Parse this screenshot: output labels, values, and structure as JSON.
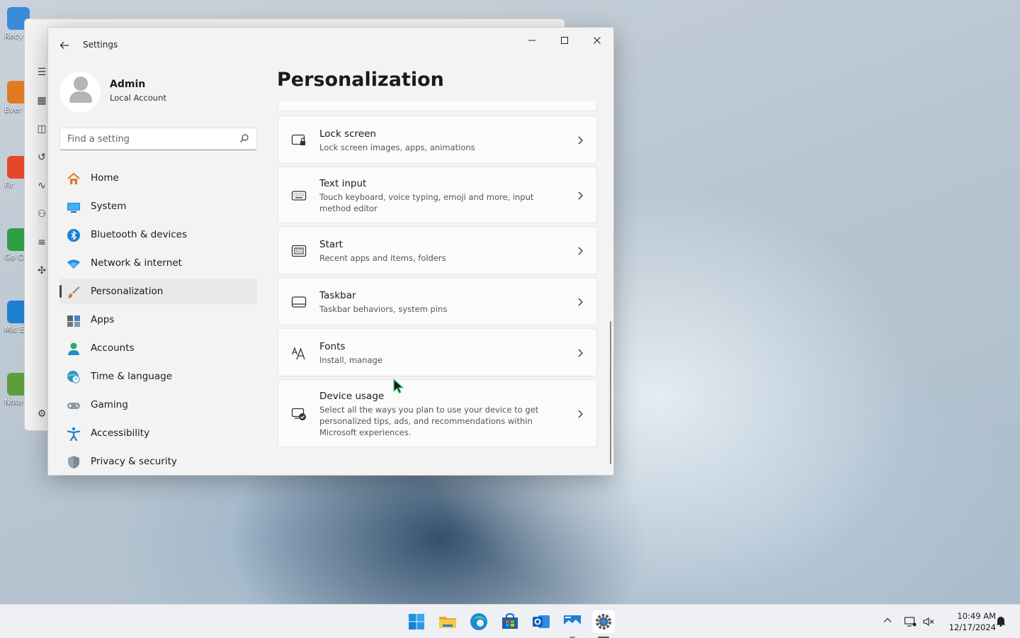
{
  "desktop": {
    "icons": [
      {
        "label": "Recy",
        "color": "#3b8ad9"
      },
      {
        "label": "Ever",
        "color": "#e07b20"
      },
      {
        "label": "Fir",
        "color": "#e5472a"
      },
      {
        "label": "Go Chr",
        "color": "#2f9e44"
      },
      {
        "label": "Mic Ed",
        "color": "#1f7fd1"
      },
      {
        "label": "Note",
        "color": "#5b9e3a"
      }
    ]
  },
  "window": {
    "app_title": "Settings",
    "minimize": "—",
    "maximize": "☐",
    "close": "✕"
  },
  "profile": {
    "name": "Admin",
    "account_type": "Local Account"
  },
  "search": {
    "placeholder": "Find a setting"
  },
  "nav": {
    "items": [
      {
        "label": "Home",
        "icon": "home-icon"
      },
      {
        "label": "System",
        "icon": "system-icon"
      },
      {
        "label": "Bluetooth & devices",
        "icon": "bluetooth-icon"
      },
      {
        "label": "Network & internet",
        "icon": "wifi-icon"
      },
      {
        "label": "Personalization",
        "icon": "brush-icon",
        "active": true
      },
      {
        "label": "Apps",
        "icon": "apps-icon"
      },
      {
        "label": "Accounts",
        "icon": "accounts-icon"
      },
      {
        "label": "Time & language",
        "icon": "clock-globe-icon"
      },
      {
        "label": "Gaming",
        "icon": "gamepad-icon"
      },
      {
        "label": "Accessibility",
        "icon": "accessibility-icon"
      },
      {
        "label": "Privacy & security",
        "icon": "shield-icon"
      }
    ]
  },
  "main": {
    "title": "Personalization",
    "cards": [
      {
        "title": "Lock screen",
        "desc": "Lock screen images, apps, animations"
      },
      {
        "title": "Text input",
        "desc": "Touch keyboard, voice typing, emoji and more, input method editor"
      },
      {
        "title": "Start",
        "desc": "Recent apps and items, folders"
      },
      {
        "title": "Taskbar",
        "desc": "Taskbar behaviors, system pins"
      },
      {
        "title": "Fonts",
        "desc": "Install, manage"
      },
      {
        "title": "Device usage",
        "desc": "Select all the ways you plan to use your device to get personalized tips, ads, and recommendations within Microsoft experiences."
      }
    ]
  },
  "taskbar": {
    "apps": [
      "start-icon",
      "file-explorer-icon",
      "edge-icon",
      "store-icon",
      "outlook-icon",
      "mail-icon",
      "settings-icon"
    ],
    "clock": {
      "time": "10:49 AM",
      "date": "12/17/2024"
    }
  }
}
